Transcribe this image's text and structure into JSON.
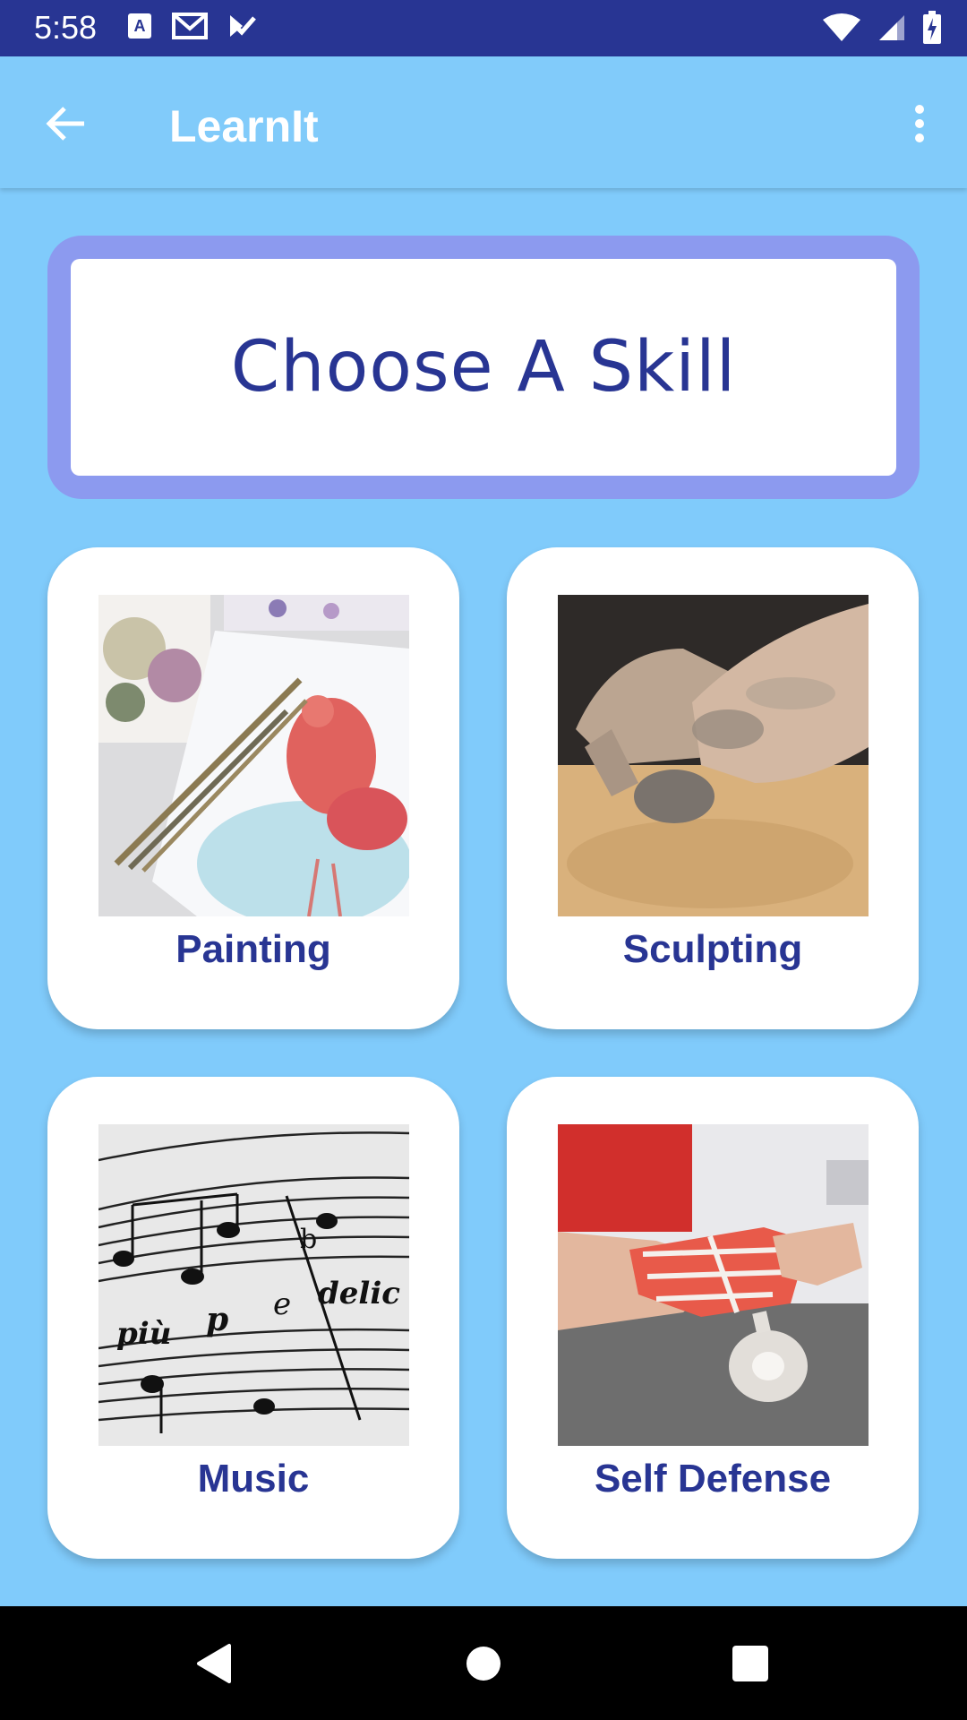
{
  "status_bar": {
    "time": "5:58",
    "left_icons": [
      "keyboard-a-icon",
      "gmail-icon",
      "task-check-icon"
    ],
    "right_icons": [
      "wifi-icon",
      "cell-signal-icon",
      "battery-charging-icon"
    ]
  },
  "app_bar": {
    "back_icon": "arrow-back-icon",
    "title": "LearnIt",
    "menu_icon": "more-vert-icon"
  },
  "header": {
    "title": "Choose A Skill"
  },
  "skills": [
    {
      "label": "Painting",
      "image": "watercolor-flamingo-brushes"
    },
    {
      "label": "Sculpting",
      "image": "hands-molding-clay"
    },
    {
      "label": "Music",
      "image": "sheet-music-notes"
    },
    {
      "label": "Self Defense",
      "image": "hand-wrapping-tape"
    }
  ],
  "nav_bar": {
    "back_icon": "nav-back-triangle-icon",
    "home_icon": "nav-home-circle-icon",
    "recents_icon": "nav-recents-square-icon"
  },
  "colors": {
    "background": "#80cbfb",
    "status_bar": "#283593",
    "accent_text": "#283593",
    "header_border": "#8c9aef",
    "card": "#ffffff"
  }
}
